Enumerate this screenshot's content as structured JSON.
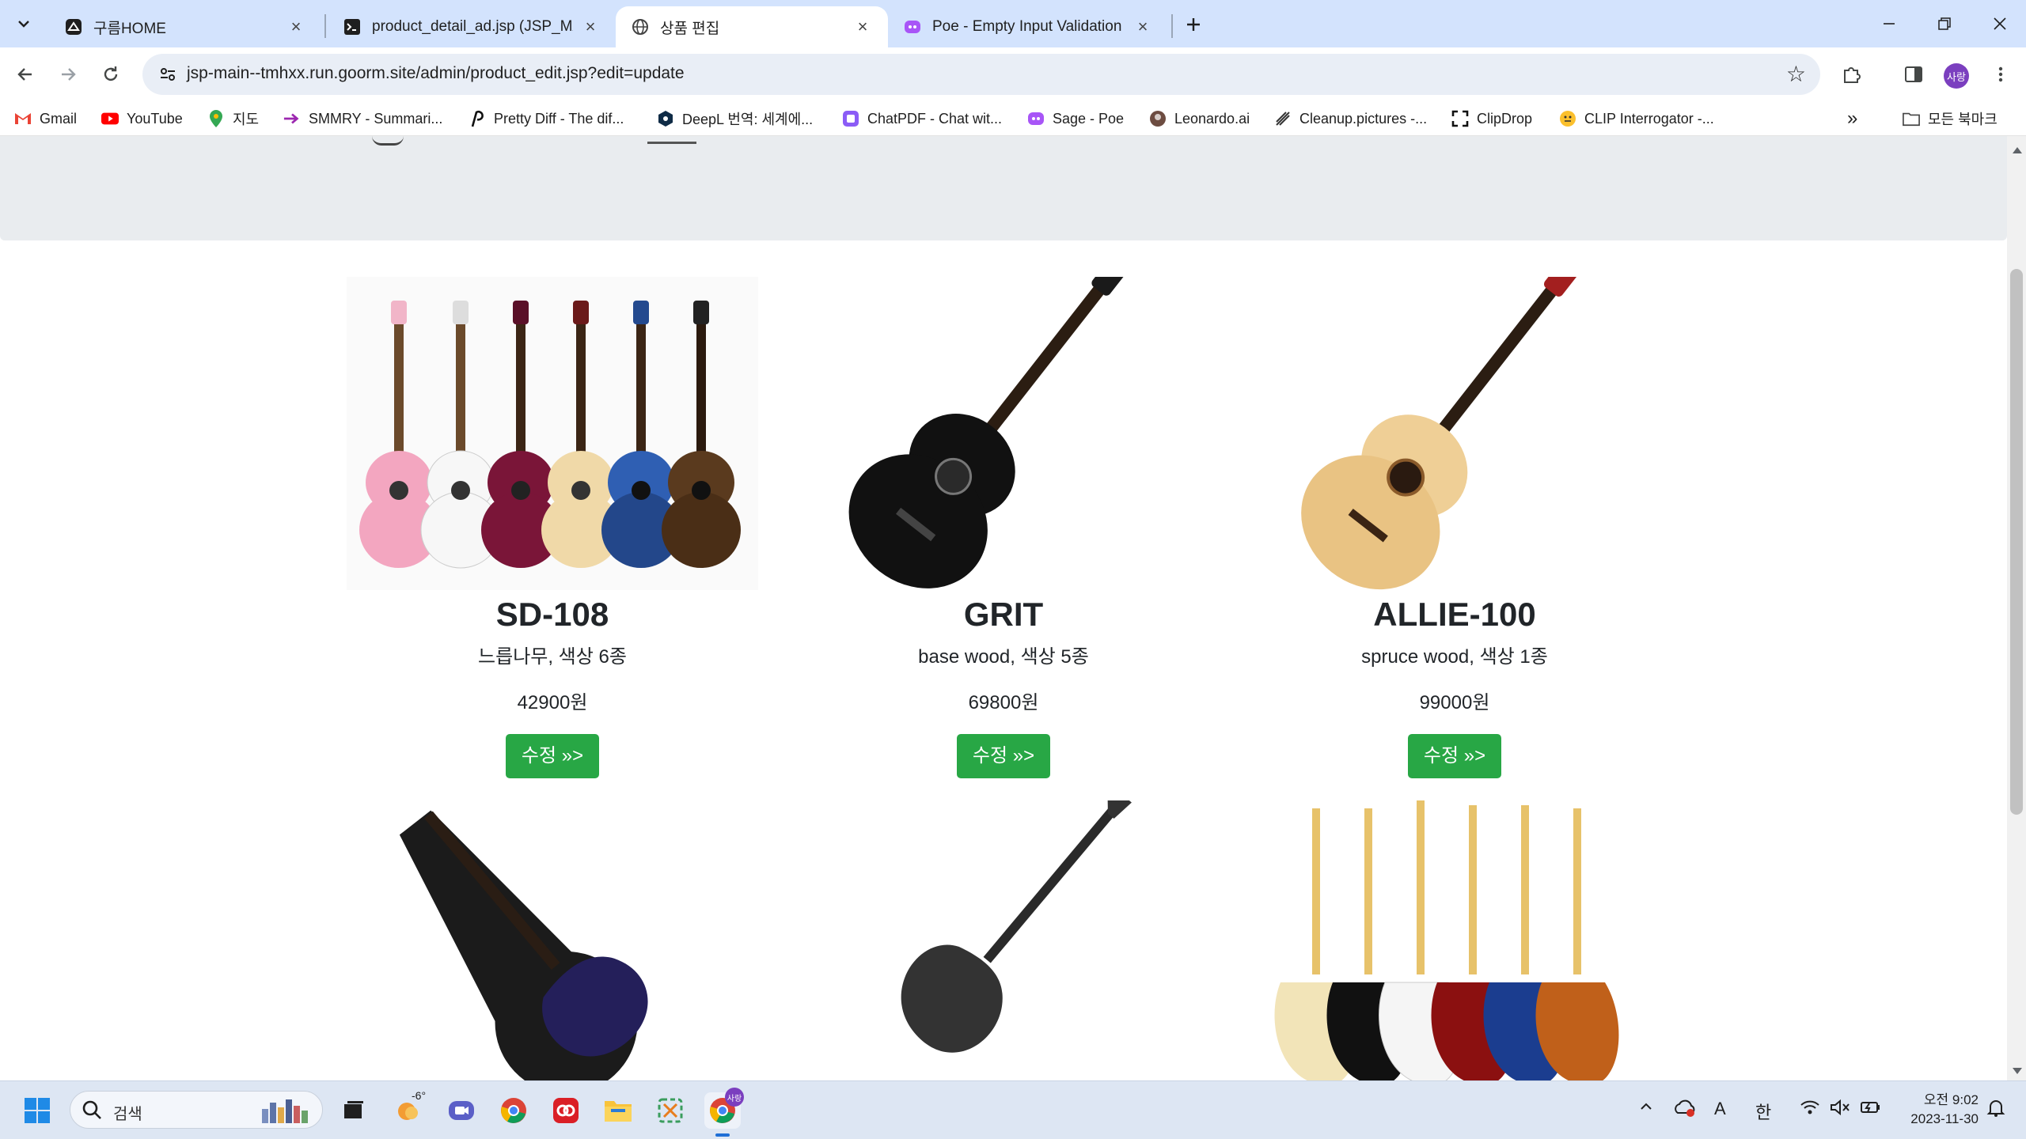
{
  "browser": {
    "tabs": [
      {
        "title": "구름HOME",
        "icon": "goorm-icon"
      },
      {
        "title": "product_detail_ad.jsp (JSP_MA",
        "icon": "terminal-icon"
      },
      {
        "title": "상품 편집",
        "icon": "globe-icon",
        "active": true
      },
      {
        "title": "Poe - Empty Input Validation",
        "icon": "poe-icon"
      }
    ],
    "url": "jsp-main--tmhxx.run.goorm.site/admin/product_edit.jsp?edit=update",
    "profile_label": "사랑",
    "bookmarks": [
      {
        "label": "Gmail",
        "icon": "gmail-icon"
      },
      {
        "label": "YouTube",
        "icon": "youtube-icon"
      },
      {
        "label": "지도",
        "icon": "maps-icon"
      },
      {
        "label": "SMMRY - Summari...",
        "icon": "smmry-icon"
      },
      {
        "label": "Pretty Diff - The dif...",
        "icon": "prettydiff-icon"
      },
      {
        "label": "DeepL 번역: 세계에...",
        "icon": "deepl-icon"
      },
      {
        "label": "ChatPDF - Chat wit...",
        "icon": "chatpdf-icon"
      },
      {
        "label": "Sage - Poe",
        "icon": "poe-icon"
      },
      {
        "label": "Leonardo.ai",
        "icon": "leonardo-icon"
      },
      {
        "label": "Cleanup.pictures -...",
        "icon": "cleanup-icon"
      },
      {
        "label": "ClipDrop",
        "icon": "clipdrop-icon"
      },
      {
        "label": "CLIP Interrogator -...",
        "icon": "clip-interrogator-icon"
      }
    ],
    "all_bookmarks_label": "모든 북마크"
  },
  "products": [
    {
      "name": "SD-108",
      "desc": "느릅나무, 색상 6종",
      "price": "42900원",
      "button": "수정 »>"
    },
    {
      "name": "GRIT",
      "desc": "base wood, 색상 5종",
      "price": "69800원",
      "button": "수정 »>"
    },
    {
      "name": "ALLIE-100",
      "desc": "spruce wood, 색상 1종",
      "price": "99000원",
      "button": "수정 »>"
    }
  ],
  "taskbar": {
    "search_placeholder": "검색",
    "weather_temp": "-6°",
    "chrome_badge": "사랑",
    "ime_letter": "A",
    "ime_lang": "한",
    "time": "오전 9:02",
    "date": "2023-11-30"
  },
  "colors": {
    "tabstrip": "#d3e3fd",
    "edit_button": "#28a745",
    "jumbotron": "#e9ecef"
  }
}
